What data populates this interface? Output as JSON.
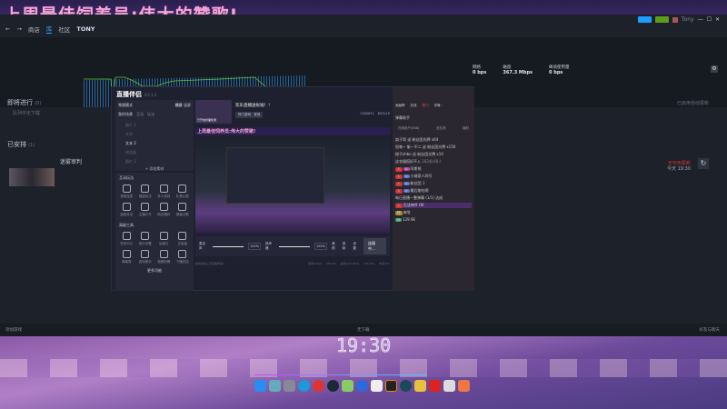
{
  "overlay_title": "上周最佳饲养员:伟大的赞歌!",
  "steam": {
    "nav": [
      "商店",
      "库",
      "社区",
      "TONY"
    ],
    "user": "Tony",
    "net": [
      {
        "label": "网络",
        "value": "0 bps"
      },
      {
        "label": "磁盘",
        "value": "367.3 Mbps"
      },
      {
        "label": "峰值使用量",
        "value": "0 bps"
      }
    ],
    "upcoming": {
      "title": "即将进行",
      "count": "(0)",
      "empty": "队列中无下载"
    },
    "auto_update": "已启用自动更新",
    "scheduled": {
      "title": "已安排",
      "count": "(1)",
      "game": "迷雾审判",
      "status": "无可用更新",
      "time": "今天 19:30"
    },
    "bottom": {
      "add_game": "添加游戏",
      "downloads": "无下载",
      "friends": "好友与聊天"
    }
  },
  "live": {
    "app_name": "直播伴侣",
    "version": "4.5.1.2",
    "mode": "常规模式",
    "orient": [
      "横屏",
      "竖屏"
    ],
    "scene_tabs": [
      "我的场景",
      "互动",
      "玩法"
    ],
    "sources": [
      "图片 1",
      "文字",
      "文本 2",
      "浏览器",
      "图片 2"
    ],
    "add_source": "+ 添加素材",
    "interactive_title": "互动玩法",
    "interactive": [
      "语音连麦",
      "福袋玩法",
      "多人连线",
      "礼物心愿",
      "抽奖玩法",
      "主播口令",
      "粉丝福利",
      "弹幕点歌"
    ],
    "tools_title": "高级工具",
    "tools": [
      "任务中心",
      "音乐设置",
      "运营位",
      "正能量",
      "弹幕秀",
      "游戏助手",
      "视频剪辑",
      "下播总结"
    ],
    "more": "更多功能",
    "stream_title": "欢乐直播送祝福！！",
    "category": "热门游戏 · 其他",
    "cover_btn": "已开启封面检测",
    "share": "分享",
    "stats": [
      "1180672",
      "853119"
    ],
    "mic": "麦克风",
    "speaker": "扬声器",
    "mic_vol": "100%",
    "spk_vol": "100%",
    "actions": [
      "美颜",
      "录制",
      "设置"
    ],
    "go_live": "连接中...",
    "footer_tip": "如何快速上手直播伴侣?",
    "status": [
      "码率:0kb/s",
      "FPS:60",
      "丢帧:0(0.00%)",
      "CPU:6%",
      "内存:5%"
    ]
  },
  "chat": {
    "tabs": [
      "贡献榜",
      "在线",
      "热门",
      "详情 ›"
    ],
    "assistant": "弹幕助手",
    "filters": [
      "在线用户(808)",
      "送礼物",
      "福利"
    ],
    "gifts": [
      "扇子哥 送 粉丝团光牌 x64",
      "铅笔~ 偷一不二 送 粉丝团光牌 x150",
      "橙子zhbo 送 粉丝团光牌 x10"
    ],
    "enter": "这衣服挺好不入",
    "online": "182条/48人",
    "msgs": [
      "阿斯顿",
      "小城家人四号",
      "粉丝团 1",
      "最后能吃啊",
      "每日直播一整弹幕 (1/1) 达成",
      "至战神呼 OK",
      "来啦",
      "129.9E"
    ]
  },
  "clock": "19:30"
}
